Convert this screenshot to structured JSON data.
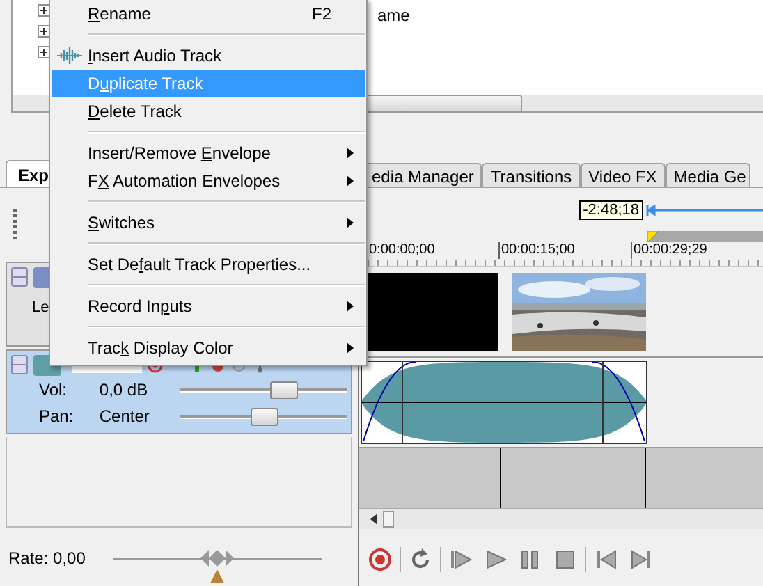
{
  "explorer": {
    "column_text": "ame"
  },
  "tabs": [
    {
      "label": "Exp",
      "selected": true
    },
    {
      "label": "edia Manager",
      "selected": false
    },
    {
      "label": "Transitions",
      "selected": false
    },
    {
      "label": "Video FX",
      "selected": false
    },
    {
      "label": "Media Ge",
      "selected": false
    }
  ],
  "timeline": {
    "time_display": "-2:48;18",
    "ruler": [
      "0:00:00;00",
      "00:00:15;00",
      "00:00:29;29"
    ]
  },
  "tracks": [
    {
      "kind": "video",
      "name": "Le",
      "selected": false
    },
    {
      "kind": "audio",
      "selected": true,
      "volume": {
        "label": "Vol:",
        "reading": "0,0 dB",
        "level": 0.62
      },
      "pan": {
        "label": "Pan:",
        "reading": "Center",
        "level": 0.5
      }
    }
  ],
  "rate": {
    "label": "Rate: 0,00",
    "level": 0.5
  },
  "context_menu": {
    "items": [
      {
        "kind": "item",
        "key": "R",
        "after": "ename",
        "shortcut": "F2",
        "selected": false,
        "submenu": false
      },
      {
        "kind": "separator"
      },
      {
        "kind": "iconitem",
        "key": "I",
        "after": "nsert Audio Track",
        "selected": false,
        "submenu": false
      },
      {
        "kind": "item",
        "before": "D",
        "key": "u",
        "after": "plicate Track",
        "selected": true,
        "submenu": false
      },
      {
        "kind": "item",
        "key": "D",
        "after": "elete Track",
        "selected": false,
        "submenu": false
      },
      {
        "kind": "separator"
      },
      {
        "kind": "item",
        "before": "Insert/Remove ",
        "key": "E",
        "after": "nvelope",
        "selected": false,
        "submenu": true
      },
      {
        "kind": "item",
        "before": "F",
        "key": "X",
        "after": " Automation Envelopes",
        "selected": false,
        "submenu": true
      },
      {
        "kind": "separator"
      },
      {
        "kind": "item",
        "key": "S",
        "after": "witches",
        "selected": false,
        "submenu": true
      },
      {
        "kind": "separator"
      },
      {
        "kind": "item",
        "before": "Set De",
        "key": "f",
        "after": "ault Track Properties...",
        "selected": false,
        "submenu": false
      },
      {
        "kind": "separator"
      },
      {
        "kind": "item",
        "before": "Record In",
        "key": "p",
        "after": "uts",
        "selected": false,
        "submenu": true
      },
      {
        "kind": "separator"
      },
      {
        "kind": "item",
        "before": "Trac",
        "key": "k",
        "after": " Display Color",
        "selected": false,
        "submenu": true
      }
    ]
  }
}
